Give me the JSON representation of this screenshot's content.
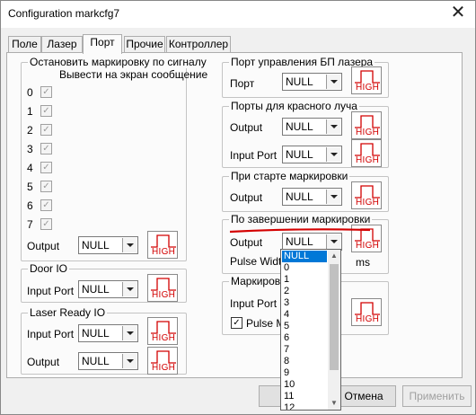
{
  "window": {
    "title": "Configuration markcfg7",
    "close_glyph": "✕"
  },
  "tabs": [
    "Поле",
    "Лазер",
    "Порт",
    "Прочие",
    "Контроллер"
  ],
  "stop_group": {
    "title": "Остановить маркировку по сигналу",
    "subtitle": "Вывести на экран сообщение",
    "signals": [
      {
        "num": "0",
        "checked": true
      },
      {
        "num": "1",
        "checked": true
      },
      {
        "num": "2",
        "checked": true
      },
      {
        "num": "3",
        "checked": true
      },
      {
        "num": "4",
        "checked": true
      },
      {
        "num": "5",
        "checked": true
      },
      {
        "num": "6",
        "checked": true
      },
      {
        "num": "7",
        "checked": true
      }
    ],
    "output_label": "Output",
    "output_value": "NULL"
  },
  "door_group": {
    "title": "Door IO",
    "input_label": "Input Port",
    "input_value": "NULL"
  },
  "laser_ready_group": {
    "title": "Laser Ready IO",
    "input_label": "Input Port",
    "input_value": "NULL",
    "output_label": "Output",
    "output_value": "NULL"
  },
  "psu_group": {
    "title": "Порт управления БП лазера",
    "port_label": "Порт",
    "port_value": "NULL"
  },
  "red_beam_group": {
    "title": "Порты для красного луча",
    "output_label": "Output",
    "output_value": "NULL",
    "input_label": "Input Port",
    "input_value": "NULL"
  },
  "on_start_group": {
    "title": "При старте маркировки",
    "output_label": "Output",
    "output_value": "NULL"
  },
  "on_finish_group": {
    "title": "По завершении маркировки",
    "output_label": "Output",
    "output_value": "NULL",
    "pulse_label": "Pulse Width",
    "pulse_unit": "ms",
    "accent_color": "#d40000"
  },
  "marking_group": {
    "title": "Маркировк",
    "input_label": "Input Port",
    "pulse_label": "Pulse M",
    "pulse_checked": true
  },
  "high_button": {
    "label": "HIGH",
    "color": "#d20000",
    "icon": "pulse-waveform-icon"
  },
  "footer": {
    "ok_label": "",
    "cancel_label": "Отмена",
    "apply_label": "Применить"
  },
  "dropdown": {
    "items": [
      "NULL",
      "0",
      "1",
      "2",
      "3",
      "4",
      "5",
      "6",
      "7",
      "8",
      "9",
      "10",
      "11",
      "12"
    ],
    "selected": "NULL"
  }
}
